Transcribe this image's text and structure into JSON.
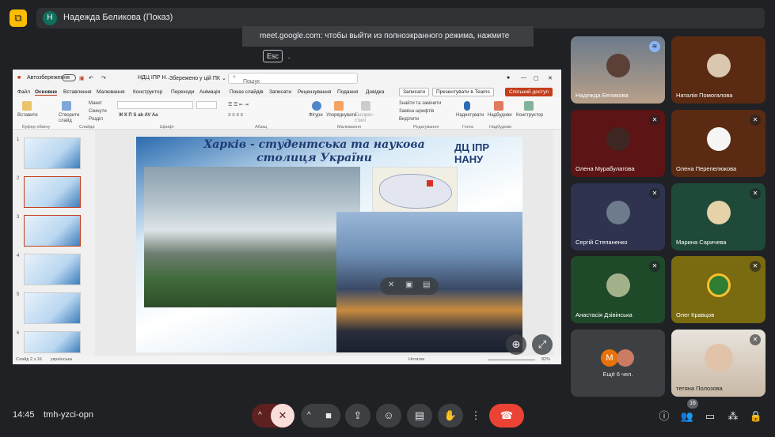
{
  "header": {
    "presenter_initial": "Н",
    "presenter_label": "Надежда Беликова (Показ)",
    "fullscreen_toast_prefix": "meet.google.com: чтобы выйти из полноэкранного режима, нажмите",
    "fullscreen_toast_key": "Esc",
    "fullscreen_toast_suffix": "."
  },
  "powerpoint": {
    "autosave_label": "Автозбереження",
    "file_name": "НДЦ ІПР Н...",
    "saved_label": "Збережено у цій ПК ⌄",
    "search_placeholder": "Пошук",
    "tabs": [
      "Файл",
      "Основне",
      "Вставлення",
      "Малювання",
      "Конструктор",
      "Переходи",
      "Анімація",
      "Показ слайдів",
      "Записати",
      "Рецензування",
      "Подання",
      "Довідка"
    ],
    "active_tab": "Основне",
    "record_button": "Записати",
    "teams_button": "Презентувати в Teams",
    "share_button": "Спільний доступ",
    "ribbon_groups": [
      "Буфер обміну",
      "Слайди",
      "Шрифт",
      "Абзац",
      "Малювання",
      "Редагування",
      "Голос",
      "Надбудови"
    ],
    "ribbon_buttons": [
      "Вставити",
      "Створити слайд",
      "Макет",
      "Скинути",
      "Розділ",
      "Фігури",
      "Упорядкувати",
      "Експрес-стилі",
      "Знайти та замінити",
      "Заміна шрифтів",
      "Виділити",
      "Надиктувати",
      "Надбудови",
      "Конструктор"
    ],
    "slide_numbers": [
      "1",
      "2",
      "3",
      "4",
      "5",
      "6"
    ],
    "status_slide": "Слайд 2 з 16",
    "status_lang": "українська",
    "status_notes": "Нотатки",
    "status_zoom": "82%"
  },
  "slide": {
    "title": "Харків - студентська та наукова столиця України",
    "logo_text": "ДЦ ІПР НАНУ"
  },
  "participants": [
    {
      "name": "Надежда Беликова",
      "mic": "speaking"
    },
    {
      "name": "Наталія Помогалова",
      "mic": "none"
    },
    {
      "name": "Олена Мурабулатова",
      "mic": "muted"
    },
    {
      "name": "Олена Перепелюкова",
      "mic": "muted"
    },
    {
      "name": "Сергій Степаненко",
      "mic": "muted"
    },
    {
      "name": "Марина Саричева",
      "mic": "muted"
    },
    {
      "name": "Анастасія Дзівінська",
      "mic": "muted"
    },
    {
      "name": "Олег Кравцов",
      "mic": "muted"
    },
    {
      "name": "",
      "mic": "none"
    },
    {
      "name": "тетяна Полозова",
      "mic": "muted"
    }
  ],
  "more_tile": {
    "initial": "М",
    "label": "Ещё 6 чел."
  },
  "footer": {
    "time": "14:45",
    "meeting_code": "tmh-yzci-opn",
    "participant_count": "16"
  },
  "colors": {
    "background": "#202124",
    "hangup": "#ea4335",
    "mic_off": "#5f2120",
    "accent_present": "#fbbc04"
  }
}
